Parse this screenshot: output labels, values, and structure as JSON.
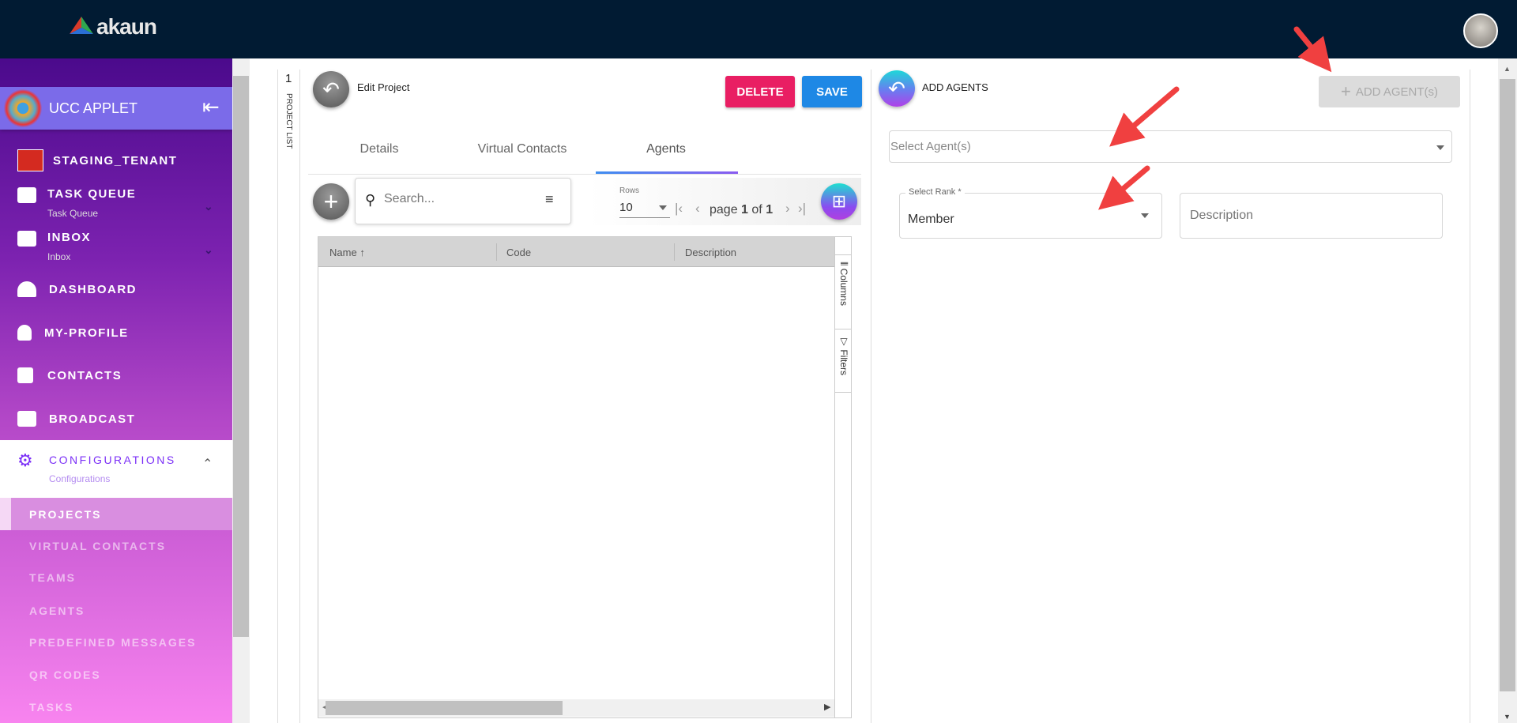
{
  "header": {
    "logo_text": "akaun",
    "avatar": "user-avatar"
  },
  "sidebar": {
    "applet": "UCC APPLET",
    "tenant": "STAGING_TENANT",
    "items": [
      {
        "label": "TASK QUEUE",
        "sub": "Task Queue",
        "icon": "task-queue-icon"
      },
      {
        "label": "INBOX",
        "sub": "Inbox",
        "icon": "inbox-icon"
      },
      {
        "label": "DASHBOARD",
        "icon": "dashboard-icon"
      },
      {
        "label": "MY-PROFILE",
        "icon": "user-icon"
      },
      {
        "label": "CONTACTS",
        "icon": "contacts-icon"
      },
      {
        "label": "BROADCAST",
        "icon": "envelope-icon"
      }
    ],
    "config": {
      "label": "CONFIGURATIONS",
      "sub": "Configurations"
    },
    "sub_items": [
      "PROJECTS",
      "VIRTUAL CONTACTS",
      "TEAMS",
      "AGENTS",
      "PREDEFINED MESSAGES",
      "QR CODES",
      "TASKS"
    ]
  },
  "project_list": {
    "count": "1",
    "label": "PROJECT LIST"
  },
  "edit_panel": {
    "title": "Edit Project",
    "delete": "DELETE",
    "save": "SAVE",
    "tabs": [
      "Details",
      "Virtual Contacts",
      "Agents"
    ],
    "active_tab": "Agents",
    "search_placeholder": "Search...",
    "rows_label": "Rows",
    "rows_value": "10",
    "page_word": "page",
    "page": "1",
    "of_word": "of",
    "total": "1",
    "columns": [
      "Name",
      "Code",
      "Description"
    ],
    "sort_icon": "↑",
    "side_columns": "Columns",
    "side_filters": "Filters"
  },
  "add_panel": {
    "title": "ADD AGENTS",
    "add_button": "ADD AGENT(s)",
    "agent_placeholder": "Select Agent(s)",
    "rank_label": "Select Rank *",
    "rank_value": "Member",
    "description_placeholder": "Description"
  },
  "colors": {
    "topbar": "#011b33",
    "delete": "#e91e63",
    "save": "#1e88e5",
    "accent": "#7b2ff7"
  }
}
